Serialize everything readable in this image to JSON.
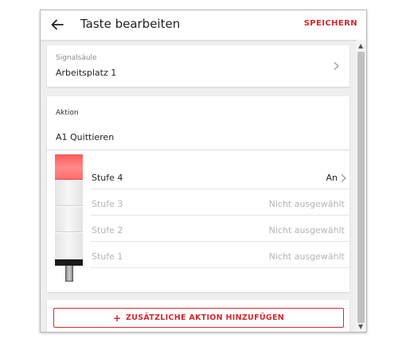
{
  "appbar": {
    "title": "Taste bearbeiten",
    "save_label": "SPEICHERN"
  },
  "signal": {
    "label": "Signalsäule",
    "value": "Arbeitsplatz 1"
  },
  "action": {
    "label": "Aktion",
    "value": "A1 Quittieren",
    "stages": [
      {
        "label": "Stufe 4",
        "status": "An"
      },
      {
        "label": "Stufe 3",
        "status": "Nicht ausgewählt"
      },
      {
        "label": "Stufe 2",
        "status": "Nicht ausgewählt"
      },
      {
        "label": "Stufe 1",
        "status": "Nicht ausgewählt"
      }
    ]
  },
  "add_action": {
    "label": "ZUSÄTZLICHE AKTION HINZUFÜGEN",
    "icon": "plus-icon"
  },
  "colors": {
    "accent": "#d9262c",
    "tower_active": "#ff6d6d"
  },
  "icons": {
    "back": "arrow-left-icon",
    "chevron": "chevron-right-icon"
  }
}
